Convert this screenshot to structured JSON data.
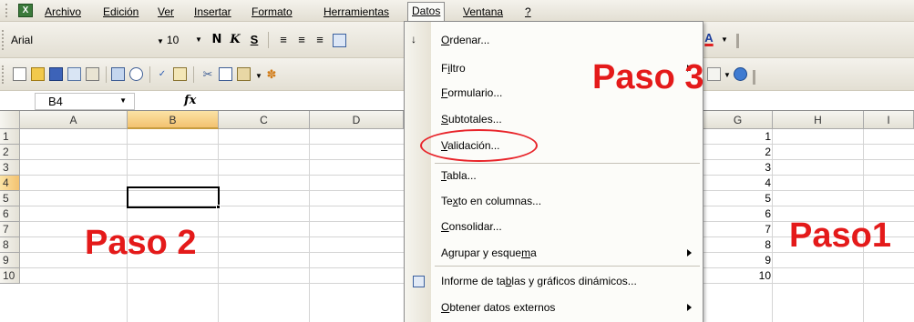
{
  "colors": {
    "step_red": "#e41a1a",
    "highlight_oval": "#e8242a",
    "selected_header": "#f3c270"
  },
  "menubar": {
    "logo": "X",
    "items": [
      "Archivo",
      "Edición",
      "Ver",
      "Insertar",
      "Formato",
      "Herramientas",
      "Datos",
      "Ventana",
      "?"
    ]
  },
  "format_toolbar": {
    "font": "Arial",
    "size": "10",
    "bold": "N",
    "italic": "K",
    "underline": "S",
    "font_color_icon": "A"
  },
  "formula_bar": {
    "name_box": "B4",
    "fx": "fx"
  },
  "grid": {
    "columns": [
      "A",
      "B",
      "C",
      "D",
      "G",
      "H",
      "I"
    ],
    "rows": [
      "1",
      "2",
      "3",
      "4",
      "5",
      "6",
      "7",
      "8",
      "9",
      "10"
    ],
    "column_g_values": [
      "1",
      "2",
      "3",
      "4",
      "5",
      "6",
      "7",
      "8",
      "9",
      "10"
    ],
    "active_cell": "B4"
  },
  "datos_menu": {
    "items": [
      {
        "pre": "",
        "u": "O",
        "post": "rdenar...",
        "submenu": false,
        "icon": "sort-icon"
      },
      {
        "pre": "F",
        "u": "i",
        "post": "ltro",
        "submenu": true,
        "icon": ""
      },
      {
        "pre": "",
        "u": "F",
        "post": "ormulario...",
        "submenu": false,
        "icon": ""
      },
      {
        "pre": "",
        "u": "S",
        "post": "ubtotales...",
        "submenu": false,
        "icon": ""
      },
      {
        "pre": "",
        "u": "V",
        "post": "alidación...",
        "submenu": false,
        "icon": ""
      },
      {
        "pre": "",
        "u": "T",
        "post": "abla...",
        "submenu": false,
        "icon": ""
      },
      {
        "pre": "Te",
        "u": "x",
        "post": "to en columnas...",
        "submenu": false,
        "icon": ""
      },
      {
        "pre": "",
        "u": "C",
        "post": "onsolidar...",
        "submenu": false,
        "icon": ""
      },
      {
        "pre": "Agrupar y esque",
        "u": "m",
        "post": "a",
        "submenu": true,
        "icon": ""
      },
      {
        "pre": "Informe de ta",
        "u": "b",
        "post": "las y gráficos dinámicos...",
        "submenu": false,
        "icon": "pivot-table-icon"
      },
      {
        "pre": "",
        "u": "O",
        "post": "btener datos externos",
        "submenu": true,
        "icon": ""
      }
    ]
  },
  "annotations": {
    "paso1": "Paso1",
    "paso2": "Paso 2",
    "paso3": "Paso 3"
  }
}
